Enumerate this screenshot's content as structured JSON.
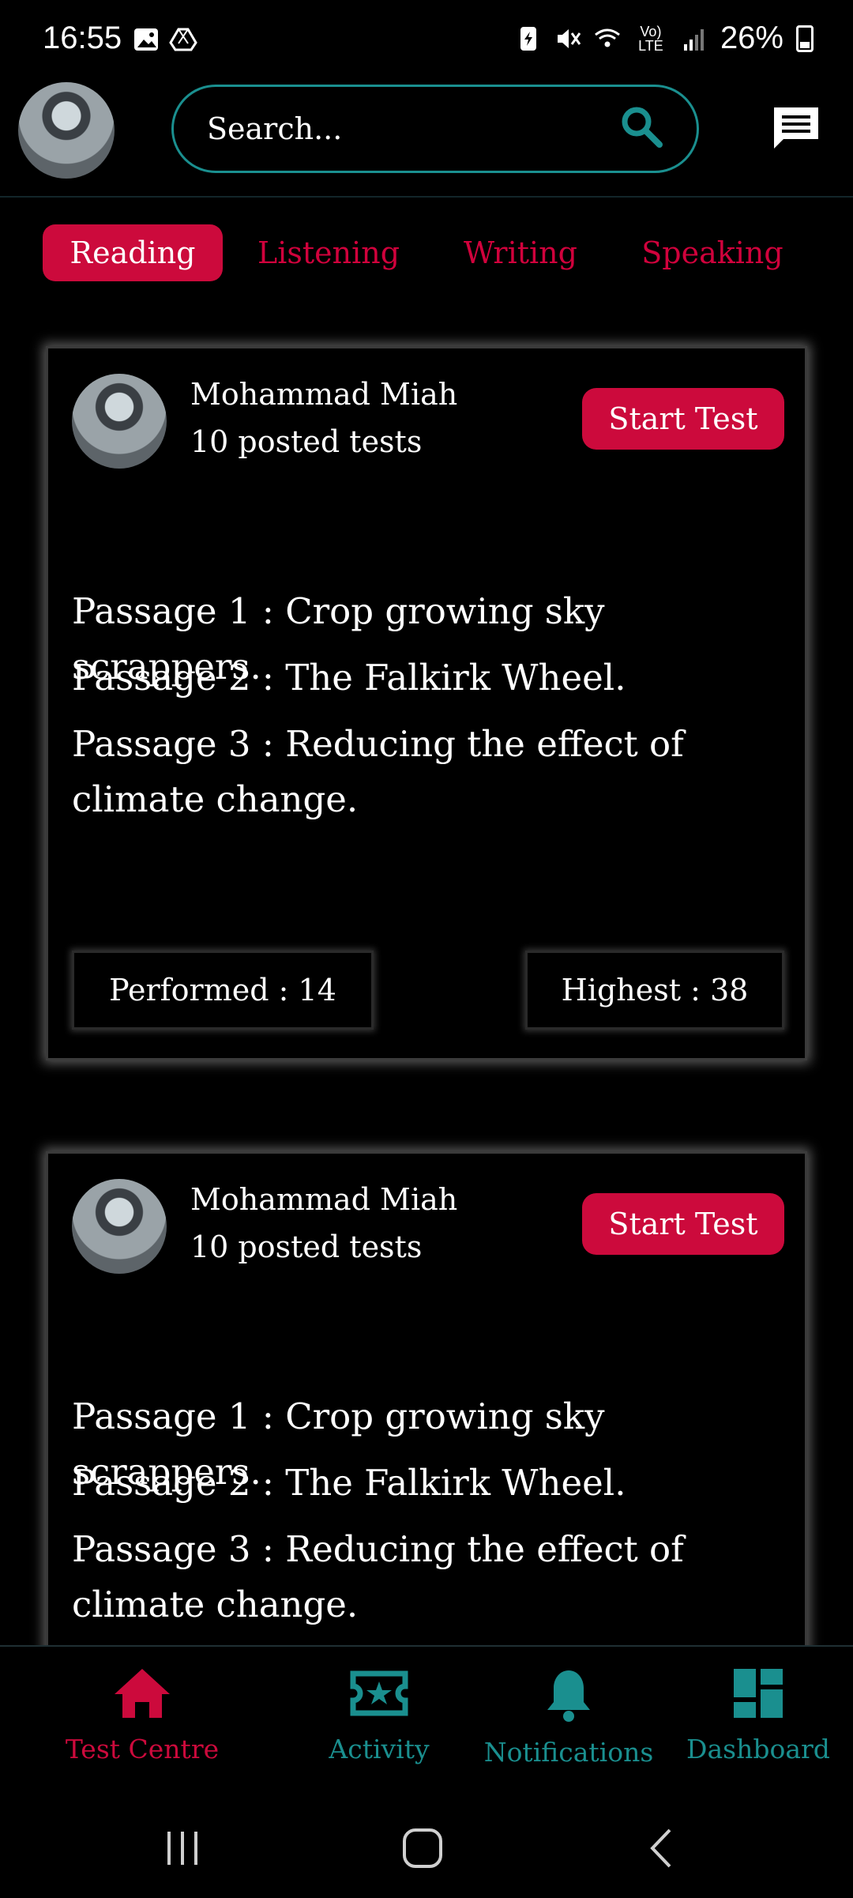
{
  "status_bar": {
    "time": "16:55",
    "battery": "26%",
    "network": "Vo) LTE"
  },
  "header": {
    "search_placeholder": "Search...",
    "icons": [
      "avatar",
      "search-icon",
      "chat-icon"
    ]
  },
  "tabs": [
    {
      "label": "Reading",
      "active": true
    },
    {
      "label": "Listening",
      "active": false
    },
    {
      "label": "Writing",
      "active": false
    },
    {
      "label": "Speaking",
      "active": false
    }
  ],
  "cards": [
    {
      "author": "Mohammad Miah",
      "posted": "10 posted tests",
      "button": "Start Test",
      "passages": [
        "Passage 1 : Crop growing sky scrappers.",
        "Passage 2 : The Falkirk Wheel.",
        "Passage 3 : Reducing the effect of climate change."
      ],
      "performed": "Performed : 14",
      "highest": "Highest : 38"
    },
    {
      "author": "Mohammad Miah",
      "posted": "10 posted tests",
      "button": "Start Test",
      "passages": [
        "Passage 1 : Crop growing sky scrappers.",
        "Passage 2 : The Falkirk Wheel.",
        "Passage 3 : Reducing the effect of climate change."
      ]
    }
  ],
  "bottom_nav": [
    {
      "label": "Test Centre",
      "icon": "home-icon",
      "active": true
    },
    {
      "label": "Activity",
      "icon": "ticket-star-icon",
      "active": false
    },
    {
      "label": "Notifications",
      "icon": "bell-icon",
      "active": false
    },
    {
      "label": "Dashboard",
      "icon": "dashboard-icon",
      "active": false
    }
  ],
  "colors": {
    "accent": "#cc0a3c",
    "teal": "#1a8f8f",
    "background": "#000000"
  }
}
